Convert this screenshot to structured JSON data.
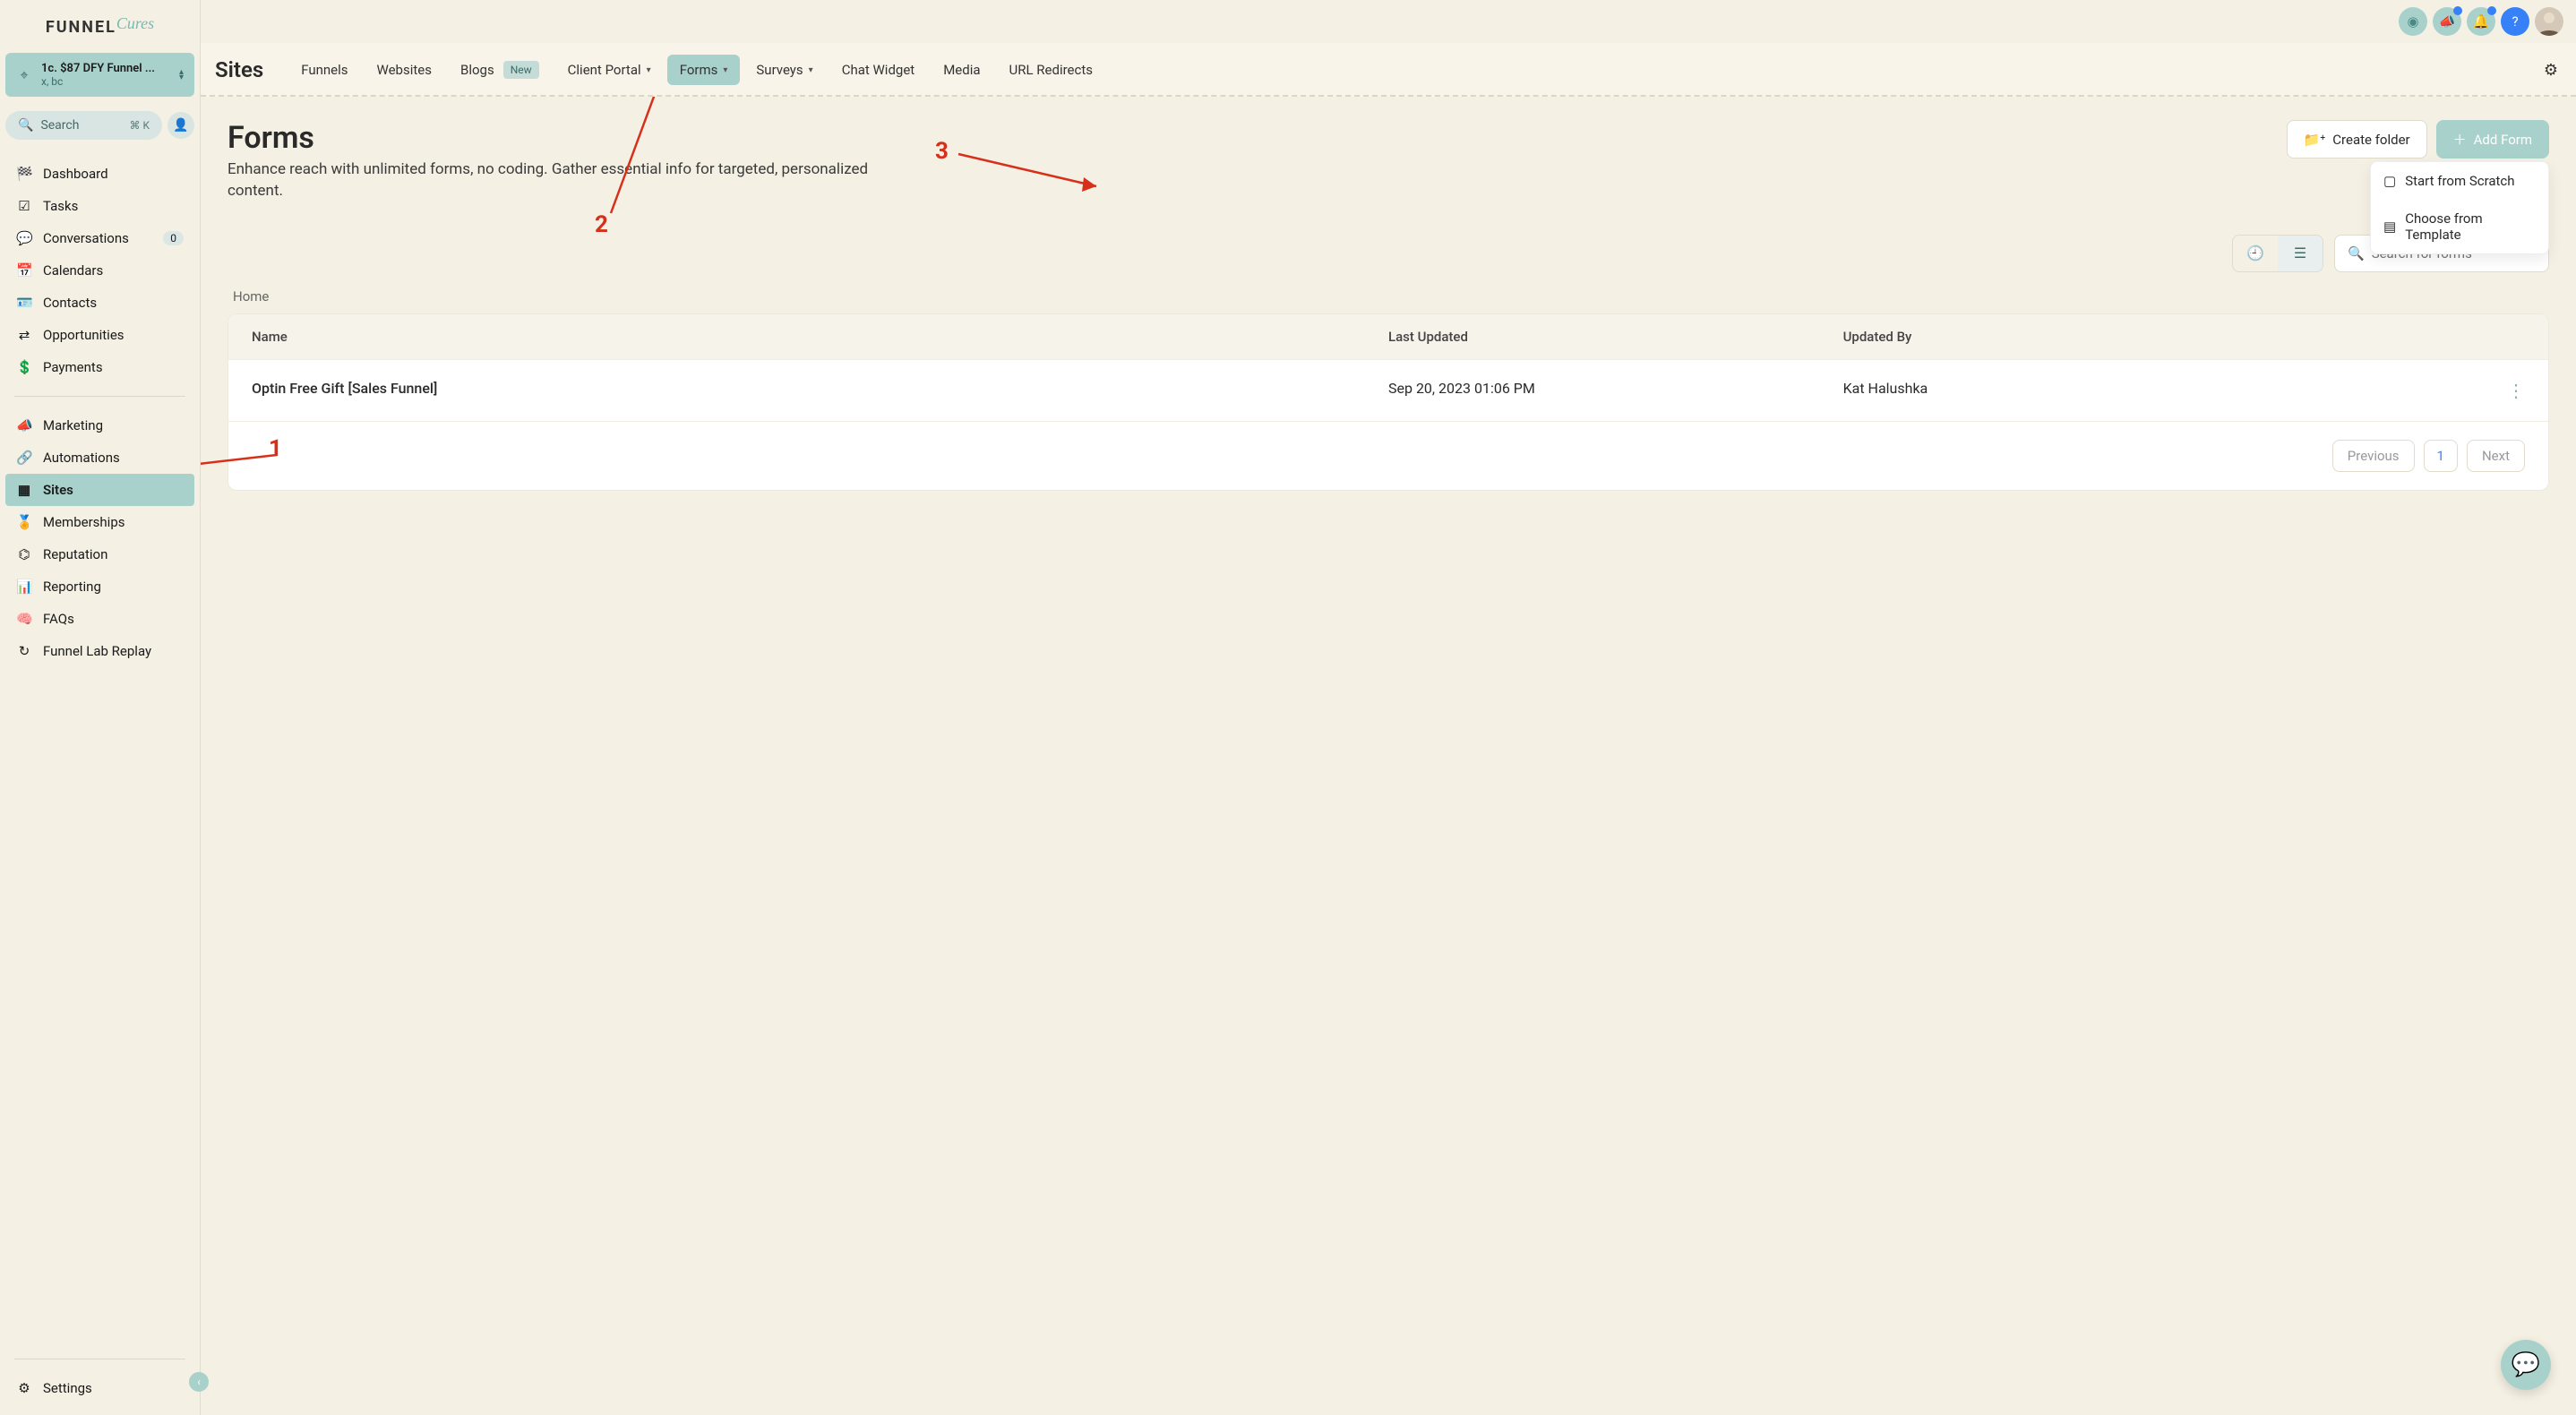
{
  "logo": {
    "main": "FUNNEL",
    "sub": "Cures"
  },
  "account": {
    "title": "1c. $87 DFY Funnel ...",
    "sub": "x, bc"
  },
  "sidebarSearch": {
    "placeholder": "Search",
    "kbd": "⌘ K"
  },
  "conversations_badge": "0",
  "nav1": [
    {
      "label": "Dashboard",
      "icon": "gauge-icon"
    },
    {
      "label": "Tasks",
      "icon": "tasks-icon"
    },
    {
      "label": "Conversations",
      "icon": "chat-icon",
      "badge": true
    },
    {
      "label": "Calendars",
      "icon": "calendar-icon"
    },
    {
      "label": "Contacts",
      "icon": "id-icon"
    },
    {
      "label": "Opportunities",
      "icon": "branch-icon"
    },
    {
      "label": "Payments",
      "icon": "money-icon"
    }
  ],
  "nav2": [
    {
      "label": "Marketing",
      "icon": "megaphone-icon"
    },
    {
      "label": "Automations",
      "icon": "link-icon"
    },
    {
      "label": "Sites",
      "icon": "layout-icon",
      "active": true
    },
    {
      "label": "Memberships",
      "icon": "award-icon"
    },
    {
      "label": "Reputation",
      "icon": "speed-icon"
    },
    {
      "label": "Reporting",
      "icon": "bars-icon"
    },
    {
      "label": "FAQs",
      "icon": "brain-icon"
    },
    {
      "label": "Funnel Lab Replay",
      "icon": "replay-icon"
    }
  ],
  "settings_label": "Settings",
  "subnav": {
    "heading": "Sites",
    "items": [
      {
        "label": "Funnels"
      },
      {
        "label": "Websites"
      },
      {
        "label": "Blogs",
        "new": true
      },
      {
        "label": "Client Portal",
        "chev": true
      },
      {
        "label": "Forms",
        "chev": true,
        "active": true
      },
      {
        "label": "Surveys",
        "chev": true
      },
      {
        "label": "Chat Widget"
      },
      {
        "label": "Media"
      },
      {
        "label": "URL Redirects"
      }
    ],
    "new_badge": "New"
  },
  "page": {
    "title": "Forms",
    "subtitle": "Enhance reach with unlimited forms, no coding. Gather essential info for targeted, personalized content.",
    "create_folder": "Create folder",
    "add_form": "Add Form",
    "dd_scratch": "Start from Scratch",
    "dd_template": "Choose from Template",
    "search_placeholder": "Search for forms",
    "breadcrumb": "Home"
  },
  "table": {
    "headers": {
      "name": "Name",
      "updated": "Last Updated",
      "by": "Updated By"
    },
    "rows": [
      {
        "name": "Optin Free Gift [Sales Funnel]",
        "updated": "Sep 20, 2023 01:06 PM",
        "by": "Kat Halushka"
      }
    ],
    "prev": "Previous",
    "page": "1",
    "next": "Next"
  },
  "anno": {
    "n1": "1",
    "n2": "2",
    "n3": "3"
  }
}
